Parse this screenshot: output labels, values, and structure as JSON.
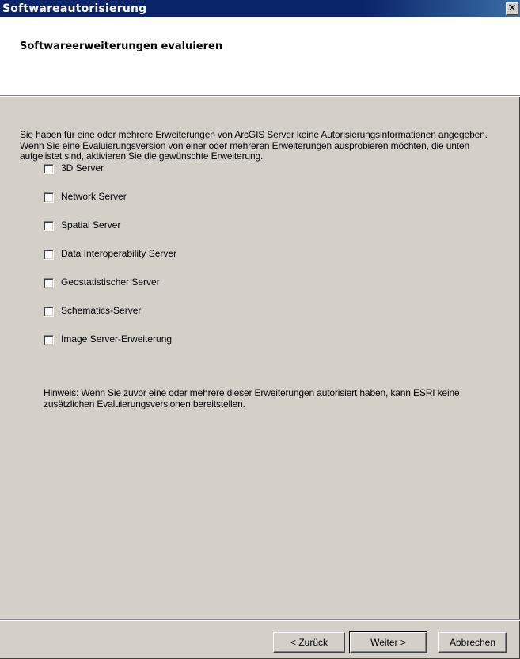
{
  "window": {
    "title": "Softwareautorisierung",
    "close_glyph": "✕"
  },
  "header": {
    "title": "Softwareerweiterungen evaluieren"
  },
  "content": {
    "intro": "Sie haben für eine oder mehrere Erweiterungen von ArcGIS Server keine Autorisierungsinformationen angegeben. Wenn Sie eine Evaluierungsversion von einer oder mehreren Erweiterungen ausprobieren möchten, die unten aufgelistet sind, aktivieren Sie die gewünschte Erweiterung.",
    "extensions": [
      {
        "label": "3D Server",
        "checked": false
      },
      {
        "label": "Network Server",
        "checked": false
      },
      {
        "label": "Spatial Server",
        "checked": false
      },
      {
        "label": "Data Interoperability Server",
        "checked": false
      },
      {
        "label": "Geostatistischer Server",
        "checked": false
      },
      {
        "label": "Schematics-Server",
        "checked": false
      },
      {
        "label": "Image Server-Erweiterung",
        "checked": false
      }
    ],
    "hint": "Hinweis: Wenn Sie zuvor eine oder mehrere dieser Erweiterungen autorisiert haben, kann ESRI keine zusätzlichen Evaluierungsversionen bereitstellen."
  },
  "footer": {
    "back_label": "< Zurück",
    "next_label": "Weiter >",
    "cancel_label": "Abbrechen"
  }
}
